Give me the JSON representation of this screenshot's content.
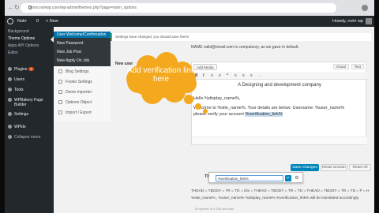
{
  "browser": {
    "url": "demo.nolrwp.com/wp-admin/themes.php?page=nolrn_options"
  },
  "adminbar": {
    "site_name": "Nolrr",
    "comments": "0",
    "new_label": "+ New",
    "greeting": "Howdy, nolrr wp"
  },
  "sidebar": {
    "items": [
      {
        "label": "Background",
        "type": "sub"
      },
      {
        "label": "Theme Options",
        "type": "active"
      },
      {
        "label": "Apps API Options",
        "type": "sub"
      },
      {
        "label": "Editor",
        "type": "sub"
      },
      {
        "label": "Plugins",
        "type": "main",
        "badge": "1"
      },
      {
        "label": "Users",
        "type": "main"
      },
      {
        "label": "Tools",
        "type": "main"
      },
      {
        "label": "WPBakery Page Builder",
        "type": "main"
      },
      {
        "label": "Settings",
        "type": "main"
      },
      {
        "label": "WPide",
        "type": "main"
      },
      {
        "label": "Collapse menu",
        "type": "sub"
      }
    ]
  },
  "flyout": {
    "items": [
      "User Welcome/Confirmation",
      "New Password",
      "New Job Post",
      "New Apply On Job"
    ]
  },
  "notice": {
    "text": "Settings have changed, you should save them!"
  },
  "intro": {
    "text": "NAME valid@email.com is compulsory, as we gave in default."
  },
  "settings_panel": {
    "items": [
      "Blog Settings",
      "Footer Settings",
      "Demo Importer",
      "Options Object",
      "Import / Export"
    ]
  },
  "new_user_label": "New user",
  "editor": {
    "add_media": "Add Media",
    "tabs": [
      "Visual",
      "Text"
    ],
    "toolbar": [
      "B",
      "I",
      "≡",
      "≡",
      "“",
      "≡",
      "≡",
      "≡",
      "→"
    ],
    "heading": "A Designing and development company",
    "hello_line": "Hello %display_name%,",
    "welcome_line_1": "Welcome to %site_name%. Your details are below: Username: %user_name%",
    "welcome_line_2": "please verify your account ",
    "verification_text": "%verification_link%",
    "thanks_label": "Thanks,",
    "link_input_value": "%verification_link%",
    "apply_icon": "↵",
    "gear_icon": "⚙"
  },
  "vars_line_1": "THEAD = TBODY = TR = TD = Div = THEAD = TBODY = TR = TD = THEAD = TBODY = TR = TD = P = H",
  "vars_line_2": "%site_name% , %user_name% %display_name% %verification_link% will be translated accordingly.",
  "buttons": {
    "save": "Save Changes",
    "reset_section": "Reset Section",
    "reset_all": "Reset All"
  },
  "footer": "18 queries in 0.326 seconds",
  "callout": {
    "text": "Add verification link here",
    "color": "#f4a81d"
  },
  "colors": {
    "admin_dark": "#23282d",
    "primary": "#0085ba",
    "accent": "#f4a81d"
  }
}
